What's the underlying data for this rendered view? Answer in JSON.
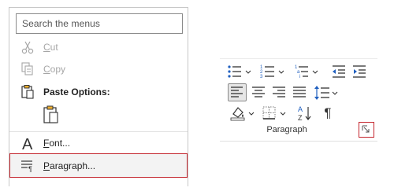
{
  "context_menu": {
    "search_placeholder": "Search the menus",
    "items": [
      {
        "label_first": "C",
        "label_rest": "ut",
        "icon": "scissors-icon",
        "disabled": true
      },
      {
        "label_first": "C",
        "label_rest": "opy",
        "icon": "copy-icon",
        "disabled": true
      },
      {
        "label": "Paste Options:"
      },
      {
        "label_first": "F",
        "label_rest": "ont...",
        "icon": "font-icon"
      },
      {
        "label_first": "P",
        "label_rest": "aragraph...",
        "icon": "paragraph-settings-icon",
        "selected": true
      }
    ],
    "paste_option_icon": "paste-keep-text-icon"
  },
  "ribbon": {
    "group_label": "Paragraph",
    "buttons": [
      "bullets-icon",
      "numbering-icon",
      "multilevel-list-icon",
      "decrease-indent-icon",
      "increase-indent-icon",
      "align-left-icon",
      "center-icon",
      "align-right-icon",
      "justify-icon",
      "line-spacing-icon",
      "shading-icon",
      "borders-icon",
      "sort-icon",
      "show-formatting-marks-icon"
    ],
    "sort_label": "AZ",
    "pilcrow": "¶",
    "launcher_icon": "dialog-launcher-icon",
    "accent_color": "#c4262e",
    "icon_blue": "#1f5fbf"
  }
}
